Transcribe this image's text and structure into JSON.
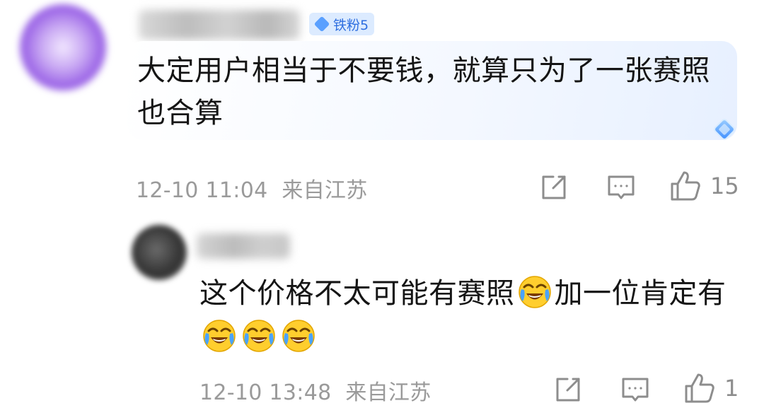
{
  "comment": {
    "badge_label": "铁粉5",
    "text": "大定用户相当于不要钱，就算只为了一张赛照也合算",
    "timestamp": "12-10 11:04",
    "location": "来自江苏",
    "like_count": "15"
  },
  "reply": {
    "text_part1": "这个价格不太可能有赛照",
    "text_part2": "加一位肯定有",
    "timestamp": "12-10 13:48",
    "location": "来自江苏",
    "like_count": "1"
  },
  "colors": {
    "accent": "#2f6fe0",
    "meta_gray": "#9a9a9a",
    "badge_bg": "#dcebff"
  }
}
